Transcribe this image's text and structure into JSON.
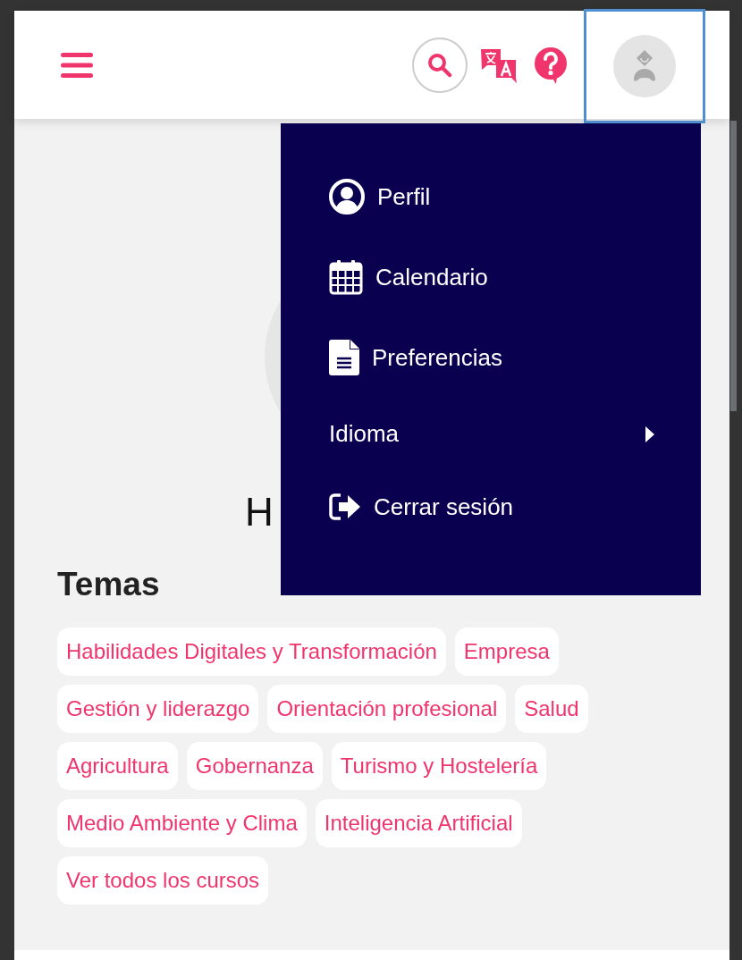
{
  "header": {
    "buttons": [
      {
        "kind": "menu"
      },
      {
        "kind": "search"
      },
      {
        "kind": "language"
      },
      {
        "kind": "help"
      },
      {
        "kind": "avatar",
        "selected": true
      }
    ]
  },
  "user_menu": {
    "items": [
      {
        "label": "Perfil",
        "kind": "link"
      },
      {
        "label": "Calendario",
        "kind": "link"
      },
      {
        "label": "Preferencias",
        "kind": "link"
      },
      {
        "label": "Idioma",
        "kind": "submenu"
      },
      {
        "label": "Cerrar sesión",
        "kind": "link"
      }
    ]
  },
  "greeting": {
    "heading": "H"
  },
  "topics": {
    "title": "Temas",
    "tags": [
      "Habilidades Digitales y Transformación",
      "Empresa",
      "Gestión y liderazgo",
      "Orientación profesional",
      "Salud",
      "Agricultura",
      "Gobernanza",
      "Turismo y Hostelería",
      "Medio Ambiente y Clima",
      "Inteligencia Artificial",
      "Ver todos los cursos"
    ]
  }
}
